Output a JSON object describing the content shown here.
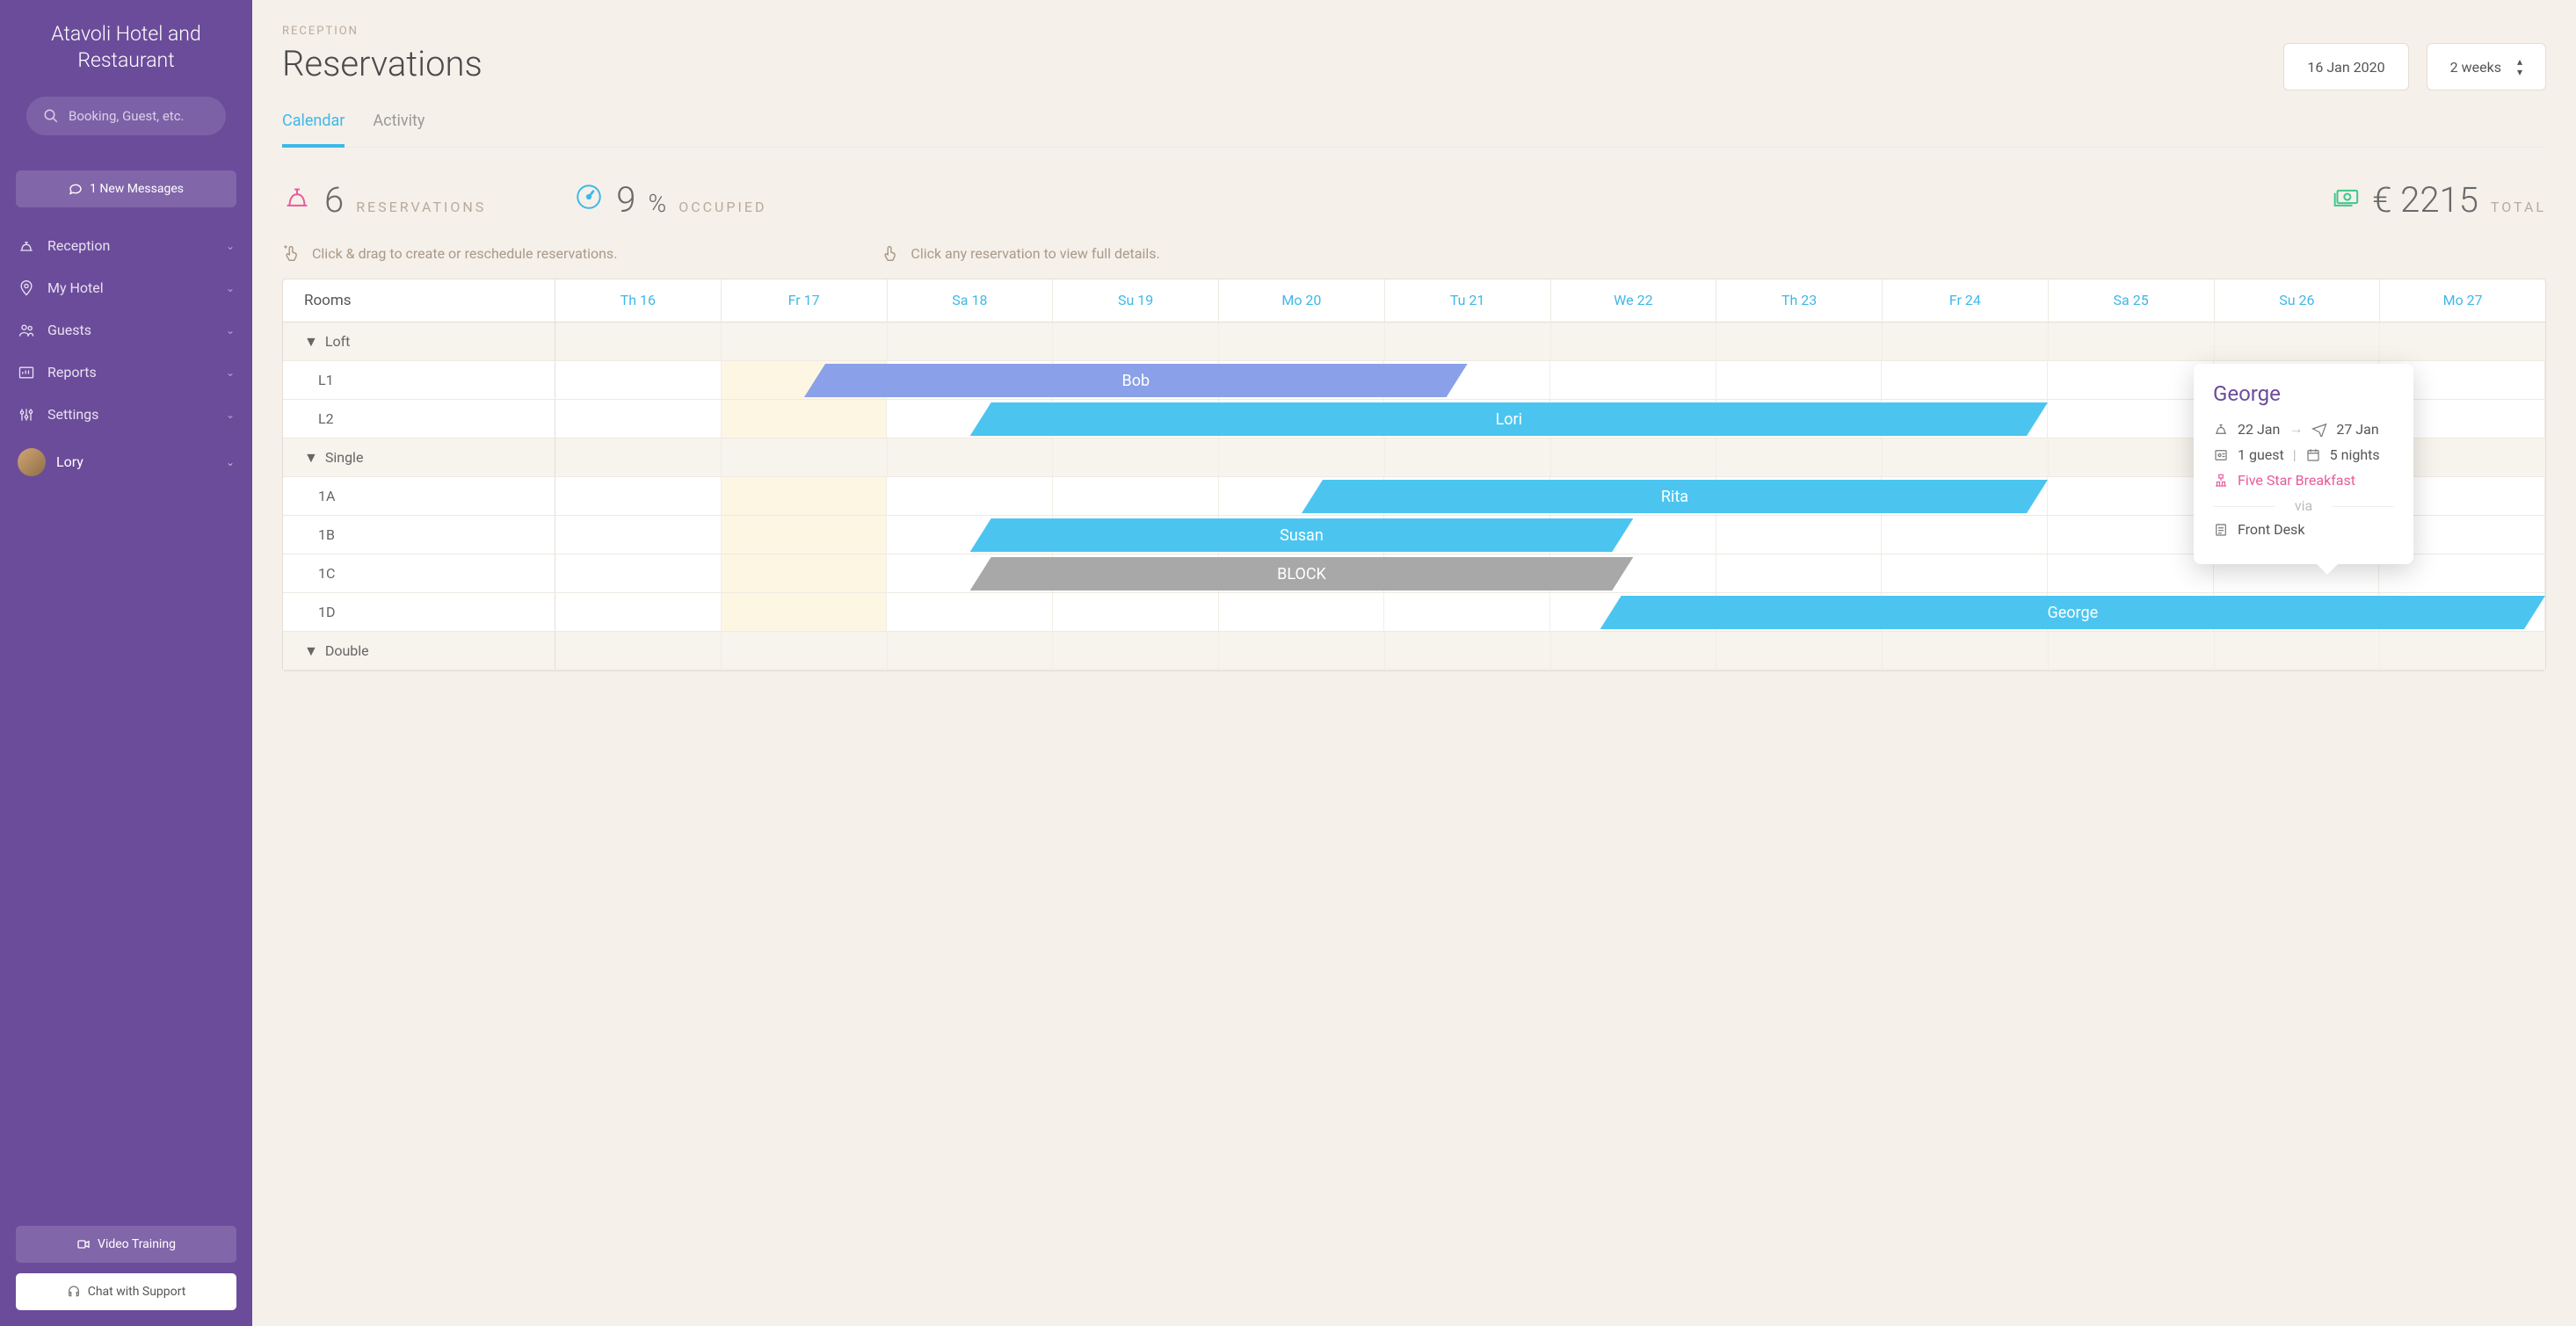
{
  "brand": "Atavoli Hotel and Restaurant",
  "search_placeholder": "Booking, Guest, etc.",
  "messages_btn": "1 New Messages",
  "nav": [
    {
      "label": "Reception"
    },
    {
      "label": "My Hotel"
    },
    {
      "label": "Guests"
    },
    {
      "label": "Reports"
    },
    {
      "label": "Settings"
    }
  ],
  "user": "Lory",
  "video_btn": "Video Training",
  "support_btn": "Chat with Support",
  "crumb": "RECEPTION",
  "title": "Reservations",
  "date_picker": "16 Jan 2020",
  "range_picker": "2 weeks",
  "tabs": {
    "calendar": "Calendar",
    "activity": "Activity"
  },
  "stats": {
    "reservations_n": "6",
    "reservations_l": "RESERVATIONS",
    "occupied_n": "9",
    "occupied_pct": "%",
    "occupied_l": "OCCUPIED",
    "total_n": "€ 2215",
    "total_l": "TOTAL"
  },
  "hints": {
    "drag": "Click & drag to create or reschedule reservations.",
    "click": "Click any reservation to view full details."
  },
  "days": [
    "Th 16",
    "Fr 17",
    "Sa 18",
    "Su 19",
    "Mo 20",
    "Tu 21",
    "We 22",
    "Th 23",
    "Fr 24",
    "Sa 25",
    "Su 26",
    "Mo 27"
  ],
  "rooms_header": "Rooms",
  "groups": [
    {
      "name": "Loft",
      "rooms": [
        "L1",
        "L2"
      ]
    },
    {
      "name": "Single",
      "rooms": [
        "1A",
        "1B",
        "1C",
        "1D"
      ]
    },
    {
      "name": "Double",
      "rooms": []
    }
  ],
  "bars": {
    "bob": "Bob",
    "lori": "Lori",
    "rita": "Rita",
    "susan": "Susan",
    "block": "BLOCK",
    "george": "George"
  },
  "popover": {
    "name": "George",
    "from": "22 Jan",
    "to": "27 Jan",
    "arrow": "→",
    "guests": "1 guest",
    "nights": "5 nights",
    "sep": "|",
    "plan": "Five Star Breakfast",
    "via": "via",
    "source": "Front Desk"
  }
}
